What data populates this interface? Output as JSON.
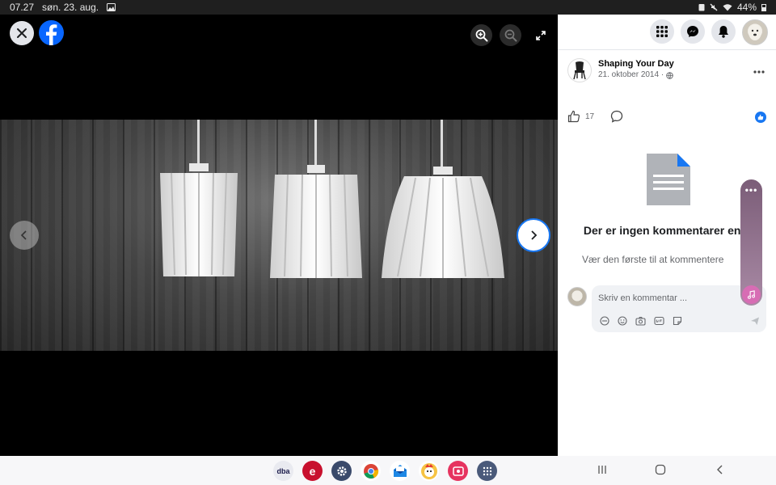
{
  "status_bar": {
    "time": "07.27",
    "date": "søn. 23. aug.",
    "battery": "44%"
  },
  "viewer": {
    "close_icon": "close-icon",
    "logo_icon": "facebook-logo-icon",
    "zoom_in_icon": "zoom-in-icon",
    "zoom_out_icon": "zoom-out-icon",
    "fullscreen_icon": "fullscreen-icon",
    "prev_icon": "chevron-left-icon",
    "next_icon": "chevron-right-icon"
  },
  "post": {
    "page_name": "Shaping Your Day",
    "date": "21. oktober 2014 ·",
    "like_count": "17"
  },
  "comments": {
    "empty_title": "Der er ingen kommentarer endnu",
    "empty_subtitle": "Vær den første til at kommentere",
    "input_placeholder": "Skriv en kommentar ..."
  },
  "dock": {
    "apps": [
      "dba",
      "e"
    ]
  },
  "colors": {
    "facebook_blue": "#0866ff",
    "like_blue": "#1877f2",
    "panel_bg": "#ffffff",
    "viewer_bg": "#000000"
  }
}
